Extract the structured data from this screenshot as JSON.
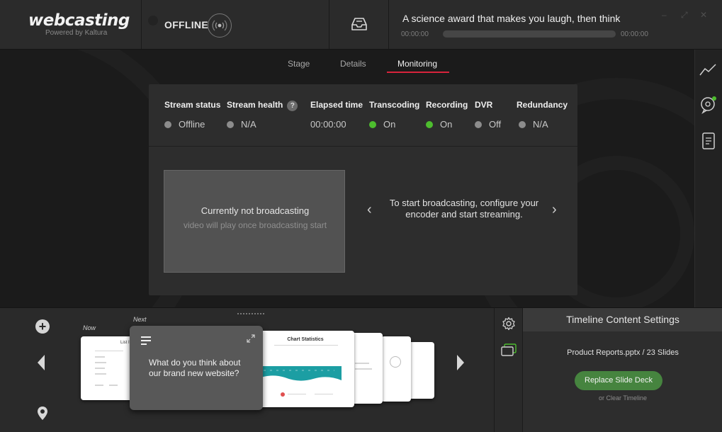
{
  "app": {
    "logo_title": "webcasting",
    "logo_sub": "Powered by Kaltura",
    "status": "OFFLINE",
    "event_title": "A science award that makes you laugh, then think",
    "time_start": "00:00:00",
    "time_end": "00:00:00",
    "window_controls": [
      "–",
      "⤢",
      "✕"
    ]
  },
  "tabs": [
    {
      "label": "Stage",
      "active": false
    },
    {
      "label": "Details",
      "active": false
    },
    {
      "label": "Monitoring",
      "active": true
    }
  ],
  "monitoring": {
    "columns": [
      {
        "title": "Stream status",
        "value": "Offline",
        "state": "gray"
      },
      {
        "title": "Stream health",
        "value": "N/A",
        "state": "gray",
        "help": "?"
      },
      {
        "title": "Elapsed time",
        "value": "00:00:00",
        "state": "none"
      },
      {
        "title": "Transcoding",
        "value": "On",
        "state": "green"
      },
      {
        "title": "Recording",
        "value": "On",
        "state": "green"
      },
      {
        "title": "DVR",
        "value": "Off",
        "state": "gray"
      },
      {
        "title": "Redundancy",
        "value": "N/A",
        "state": "gray"
      }
    ],
    "preview_title": "Currently not broadcasting",
    "preview_sub": "video will play once broadcasting start",
    "carousel_text": "To start broadcasting, configure your encoder and start streaming.",
    "prev_glyph": "‹",
    "next_glyph": "›"
  },
  "timeline": {
    "label_now": "Now",
    "label_next": "Next",
    "next_card_text": "What do you think about our brand new website?",
    "chart_slide_title": "Chart Statistics",
    "list_slide_title": "List It"
  },
  "timeline_settings": {
    "header": "Timeline Content Settings",
    "deck_name": "Product Reports.pptx / 23 Slides",
    "replace_button": "Replace Slide Deck",
    "clear_link": "or Clear Timeline"
  },
  "colors": {
    "accent_red": "#d8233c",
    "status_green": "#4dbd2e",
    "button_green": "#46843f"
  }
}
